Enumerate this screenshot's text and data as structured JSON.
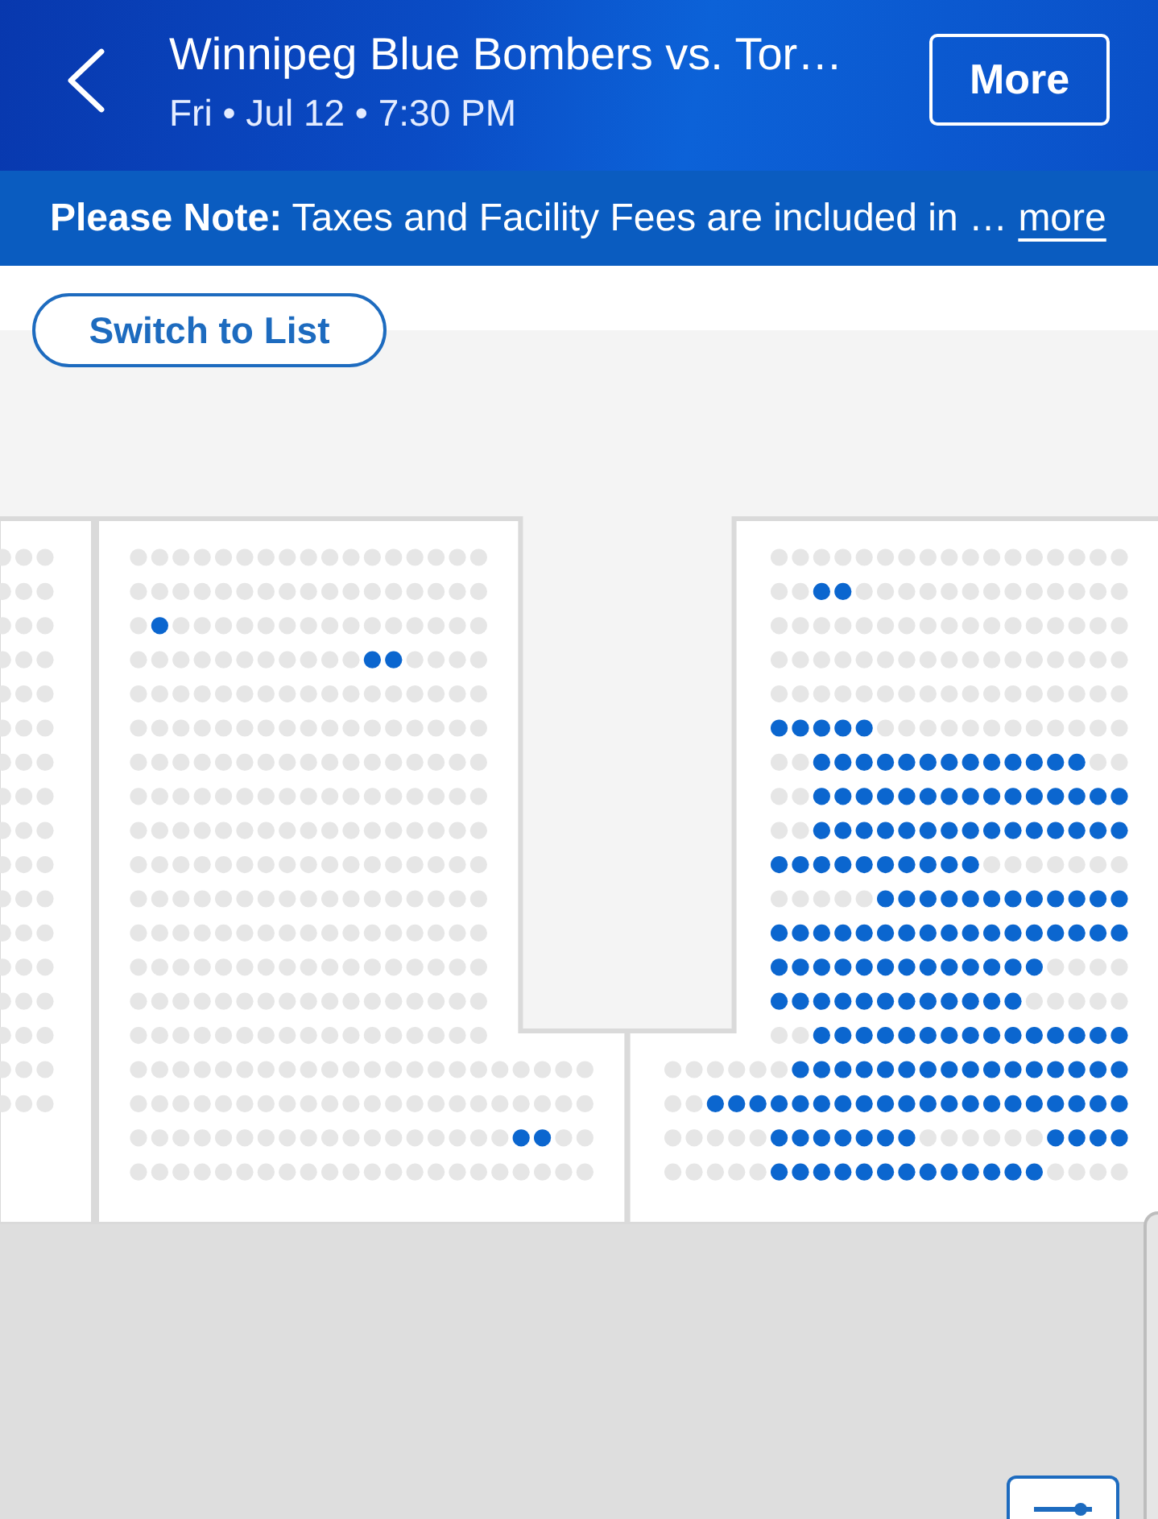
{
  "header": {
    "title": "Winnipeg Blue Bombers vs. Tor…",
    "subtitle": "Fri • Jul 12 • 7:30 PM",
    "more_button": "More"
  },
  "note": {
    "text": "**Please Note:** Taxes and Facility Fees are included in …",
    "link": "more"
  },
  "switch_button": "Switch to List",
  "sections": [
    {
      "rows": [
        {
          "available": [
            false,
            false,
            false
          ]
        },
        {
          "available": [
            false,
            false,
            false
          ]
        },
        {
          "available": [
            false,
            false,
            false
          ]
        },
        {
          "available": [
            false,
            false,
            false
          ]
        },
        {
          "available": [
            false,
            false,
            false
          ]
        },
        {
          "available": [
            false,
            false,
            false
          ]
        },
        {
          "available": [
            false,
            false,
            false
          ]
        },
        {
          "available": [
            false,
            false,
            false
          ]
        },
        {
          "available": [
            false,
            false,
            false
          ]
        },
        {
          "available": [
            false,
            false,
            false
          ]
        },
        {
          "available": [
            false,
            false,
            false
          ]
        },
        {
          "available": [
            false,
            false,
            false
          ]
        },
        {
          "available": [
            false,
            false,
            false
          ]
        },
        {
          "available": [
            false,
            false,
            false
          ]
        },
        {
          "available": [
            false,
            false,
            false
          ]
        },
        {
          "available": [
            false,
            false,
            false
          ]
        },
        {
          "available": [
            false,
            false,
            false
          ]
        }
      ]
    },
    {
      "rows": [
        {
          "available": [
            false,
            false,
            false,
            false,
            false,
            false,
            false,
            false,
            false,
            false,
            false,
            false,
            false,
            false,
            false,
            false,
            false
          ]
        },
        {
          "available": [
            false,
            false,
            false,
            false,
            false,
            false,
            false,
            false,
            false,
            false,
            false,
            false,
            false,
            false,
            false,
            false,
            false
          ]
        },
        {
          "available": [
            false,
            true,
            false,
            false,
            false,
            false,
            false,
            false,
            false,
            false,
            false,
            false,
            false,
            false,
            false,
            false,
            false
          ]
        },
        {
          "available": [
            false,
            false,
            false,
            false,
            false,
            false,
            false,
            false,
            false,
            false,
            false,
            true,
            true,
            false,
            false,
            false,
            false
          ]
        },
        {
          "available": [
            false,
            false,
            false,
            false,
            false,
            false,
            false,
            false,
            false,
            false,
            false,
            false,
            false,
            false,
            false,
            false,
            false
          ]
        },
        {
          "available": [
            false,
            false,
            false,
            false,
            false,
            false,
            false,
            false,
            false,
            false,
            false,
            false,
            false,
            false,
            false,
            false,
            false
          ]
        },
        {
          "available": [
            false,
            false,
            false,
            false,
            false,
            false,
            false,
            false,
            false,
            false,
            false,
            false,
            false,
            false,
            false,
            false,
            false
          ]
        },
        {
          "available": [
            false,
            false,
            false,
            false,
            false,
            false,
            false,
            false,
            false,
            false,
            false,
            false,
            false,
            false,
            false,
            false,
            false
          ]
        },
        {
          "available": [
            false,
            false,
            false,
            false,
            false,
            false,
            false,
            false,
            false,
            false,
            false,
            false,
            false,
            false,
            false,
            false,
            false
          ]
        },
        {
          "available": [
            false,
            false,
            false,
            false,
            false,
            false,
            false,
            false,
            false,
            false,
            false,
            false,
            false,
            false,
            false,
            false,
            false
          ]
        },
        {
          "available": [
            false,
            false,
            false,
            false,
            false,
            false,
            false,
            false,
            false,
            false,
            false,
            false,
            false,
            false,
            false,
            false,
            false
          ]
        },
        {
          "available": [
            false,
            false,
            false,
            false,
            false,
            false,
            false,
            false,
            false,
            false,
            false,
            false,
            false,
            false,
            false,
            false,
            false
          ]
        },
        {
          "available": [
            false,
            false,
            false,
            false,
            false,
            false,
            false,
            false,
            false,
            false,
            false,
            false,
            false,
            false,
            false,
            false,
            false
          ]
        },
        {
          "available": [
            false,
            false,
            false,
            false,
            false,
            false,
            false,
            false,
            false,
            false,
            false,
            false,
            false,
            false,
            false,
            false,
            false
          ]
        },
        {
          "available": [
            false,
            false,
            false,
            false,
            false,
            false,
            false,
            false,
            false,
            false,
            false,
            false,
            false,
            false,
            false,
            false,
            false
          ]
        },
        {
          "available": [
            false,
            false,
            false,
            false,
            false,
            false,
            false,
            false,
            false,
            false,
            false,
            false,
            false,
            false,
            false,
            false,
            false,
            false,
            false,
            false,
            false,
            false
          ]
        },
        {
          "available": [
            false,
            false,
            false,
            false,
            false,
            false,
            false,
            false,
            false,
            false,
            false,
            false,
            false,
            false,
            false,
            false,
            false,
            false,
            false,
            false,
            false,
            false
          ]
        },
        {
          "available": [
            false,
            false,
            false,
            false,
            false,
            false,
            false,
            false,
            false,
            false,
            false,
            false,
            false,
            false,
            false,
            false,
            false,
            false,
            true,
            true,
            false,
            false
          ]
        },
        {
          "available": [
            false,
            false,
            false,
            false,
            false,
            false,
            false,
            false,
            false,
            false,
            false,
            false,
            false,
            false,
            false,
            false,
            false,
            false,
            false,
            false,
            false,
            false
          ]
        }
      ]
    },
    {
      "rows": [
        {
          "available": [
            false,
            false,
            false,
            false,
            false,
            false,
            false,
            false,
            false,
            false,
            false,
            false,
            false,
            false,
            false,
            false,
            false
          ]
        },
        {
          "available": [
            false,
            false,
            true,
            true,
            false,
            false,
            false,
            false,
            false,
            false,
            false,
            false,
            false,
            false,
            false,
            false,
            false
          ]
        },
        {
          "available": [
            false,
            false,
            false,
            false,
            false,
            false,
            false,
            false,
            false,
            false,
            false,
            false,
            false,
            false,
            false,
            false,
            false
          ]
        },
        {
          "available": [
            false,
            false,
            false,
            false,
            false,
            false,
            false,
            false,
            false,
            false,
            false,
            false,
            false,
            false,
            false,
            false,
            false
          ]
        },
        {
          "available": [
            false,
            false,
            false,
            false,
            false,
            false,
            false,
            false,
            false,
            false,
            false,
            false,
            false,
            false,
            false,
            false,
            false
          ]
        },
        {
          "available": [
            true,
            true,
            true,
            true,
            true,
            false,
            false,
            false,
            false,
            false,
            false,
            false,
            false,
            false,
            false,
            false,
            false
          ]
        },
        {
          "available": [
            false,
            false,
            true,
            true,
            true,
            true,
            true,
            true,
            true,
            true,
            true,
            true,
            true,
            true,
            true,
            false,
            false
          ]
        },
        {
          "available": [
            false,
            false,
            true,
            true,
            true,
            true,
            true,
            true,
            true,
            true,
            true,
            true,
            true,
            true,
            true,
            true,
            true
          ]
        },
        {
          "available": [
            false,
            false,
            true,
            true,
            true,
            true,
            true,
            true,
            true,
            true,
            true,
            true,
            true,
            true,
            true,
            true,
            true
          ]
        },
        {
          "available": [
            true,
            true,
            true,
            true,
            true,
            true,
            true,
            true,
            true,
            true,
            false,
            false,
            false,
            false,
            false,
            false,
            false
          ]
        },
        {
          "available": [
            false,
            false,
            false,
            false,
            false,
            true,
            true,
            true,
            true,
            true,
            true,
            true,
            true,
            true,
            true,
            true,
            true
          ]
        },
        {
          "available": [
            true,
            true,
            true,
            true,
            true,
            true,
            true,
            true,
            true,
            true,
            true,
            true,
            true,
            true,
            true,
            true,
            true
          ]
        },
        {
          "available": [
            true,
            true,
            true,
            true,
            true,
            true,
            true,
            true,
            true,
            true,
            true,
            true,
            true,
            false,
            false,
            false,
            false
          ]
        },
        {
          "available": [
            true,
            true,
            true,
            true,
            true,
            true,
            true,
            true,
            true,
            true,
            true,
            true,
            false,
            false,
            false,
            false,
            false
          ]
        },
        {
          "available": [
            false,
            false,
            true,
            true,
            true,
            true,
            true,
            true,
            true,
            true,
            true,
            true,
            true,
            true,
            true,
            true,
            true
          ]
        },
        {
          "available": [
            false,
            false,
            false,
            false,
            false,
            false,
            true,
            true,
            true,
            true,
            true,
            true,
            true,
            true,
            true,
            true,
            true,
            true,
            true,
            true,
            true,
            true
          ]
        },
        {
          "available": [
            false,
            false,
            true,
            true,
            true,
            true,
            true,
            true,
            true,
            true,
            true,
            true,
            true,
            true,
            true,
            true,
            true,
            true,
            true,
            true,
            true,
            true
          ]
        },
        {
          "available": [
            false,
            false,
            false,
            false,
            false,
            true,
            true,
            true,
            true,
            true,
            true,
            true,
            false,
            false,
            false,
            false,
            false,
            false,
            true,
            true,
            true,
            true
          ]
        },
        {
          "available": [
            false,
            false,
            false,
            false,
            false,
            true,
            true,
            true,
            true,
            true,
            true,
            true,
            true,
            true,
            true,
            true,
            true,
            true,
            false,
            false,
            false,
            false
          ]
        }
      ]
    }
  ]
}
